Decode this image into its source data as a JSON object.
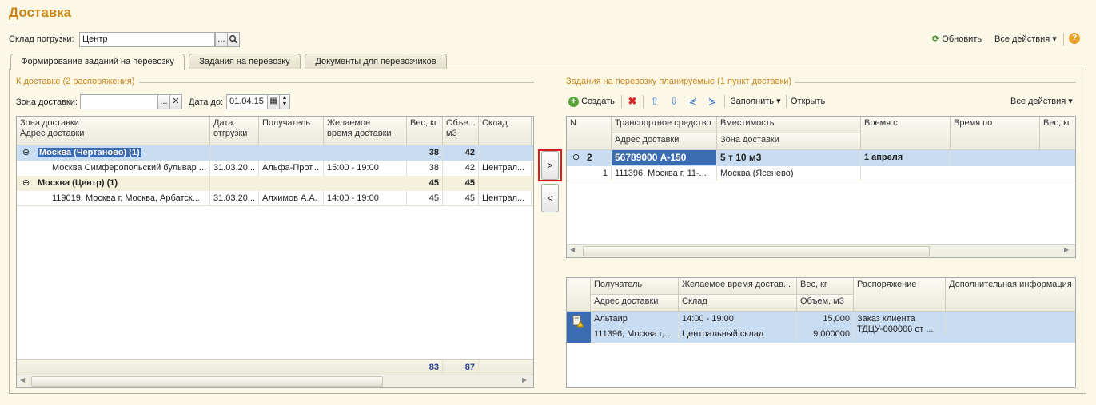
{
  "title": "Доставка",
  "warehouse": {
    "label": "Склад погрузки:",
    "value": "Центр",
    "dots": "...",
    "search_icon": "magnifier-icon"
  },
  "topbar": {
    "refresh_label": "Обновить",
    "all_actions_label": "Все действия",
    "help_icon": "help-icon"
  },
  "tabs": [
    {
      "label": "Формирование заданий на перевозку",
      "active": true
    },
    {
      "label": "Задания на перевозку",
      "active": false
    },
    {
      "label": "Документы для перевозчиков",
      "active": false
    }
  ],
  "left": {
    "section_title": "К доставке (2 распоряжения)",
    "zone_label": "Зона доставки:",
    "zone_value": "",
    "dots": "...",
    "clear": "✕",
    "date_label": "Дата до:",
    "date_value": "01.04.15",
    "columns": {
      "zone": "Зона доставки",
      "address": "Адрес доставки",
      "ship_date_1": "Дата",
      "ship_date_2": "отгрузки",
      "recipient": "Получатель",
      "time_1": "Желаемое",
      "time_2": "время доставки",
      "weight": "Вес, кг",
      "volume_1": "Объе...",
      "volume_2": "м3",
      "warehouse": "Склад"
    },
    "rows": [
      {
        "type": "group",
        "expander": "⊖",
        "name": "Москва (Чертаново) (1)",
        "weight": "38",
        "volume": "42"
      },
      {
        "type": "item",
        "address": "Москва Симферопольский бульвар ...",
        "date": "31.03.20...",
        "recipient": "Альфа-Прот...",
        "time": "15:00 - 19:00",
        "weight": "38",
        "volume": "42",
        "warehouse": "Централ..."
      },
      {
        "type": "group",
        "expander": "⊖",
        "name": "Москва (Центр) (1)",
        "weight": "45",
        "volume": "45"
      },
      {
        "type": "item",
        "address": "119019, Москва г, Москва, Арбатск...",
        "date": "31.03.20...",
        "recipient": "Алхимов А.А.",
        "time": "14:00 - 19:00",
        "weight": "45",
        "volume": "45",
        "warehouse": "Централ..."
      }
    ],
    "totals": {
      "weight": "83",
      "volume": "87"
    }
  },
  "middle": {
    "add_label": ">",
    "remove_label": "<"
  },
  "right": {
    "section_title": "Задания на перевозку планируемые (1 пункт доставки)",
    "toolbar": {
      "create_label": "Создать",
      "fill_label": "Заполнить",
      "open_label": "Открыть",
      "all_actions_label": "Все действия"
    },
    "columns": {
      "n": "N",
      "vehicle": "Транспортное средство",
      "capacity": "Вместимость",
      "time_from": "Время с",
      "time_to": "Время по",
      "weight": "Вес, кг",
      "address": "Адрес доставки",
      "zone": "Зона доставки"
    },
    "rows": [
      {
        "type": "group",
        "expander": "⊖",
        "n": "2",
        "vehicle": "56789000 А-150",
        "capacity": "5 т 10 м3",
        "time_from": "1 апреля"
      },
      {
        "type": "item",
        "n": "1",
        "address": "111396, Москва г, 11-...",
        "zone": "Москва (Ясенево)"
      }
    ]
  },
  "details": {
    "columns": {
      "recipient": "Получатель",
      "time": "Желаемое время достав...",
      "weight": "Вес, кг",
      "order": "Распоряжение",
      "info": "Дополнительная информация",
      "address": "Адрес доставки",
      "warehouse": "Склад",
      "volume": "Объем, м3"
    },
    "row": {
      "icon": "document-warning-icon",
      "recipient": "Альтаир",
      "time": "14:00 - 19:00",
      "weight": "15,000",
      "order_1": "Заказ клиента",
      "order_2": "ТДЦУ-000006 от ...",
      "address": "111396, Москва г,...",
      "warehouse": "Центральный склад",
      "volume": "9,000000"
    }
  },
  "colors": {
    "accent": "#c8861a",
    "selected_row": "#c9ddf2",
    "group_row": "#f5f1dd",
    "highlight_border": "#d81c1c"
  }
}
